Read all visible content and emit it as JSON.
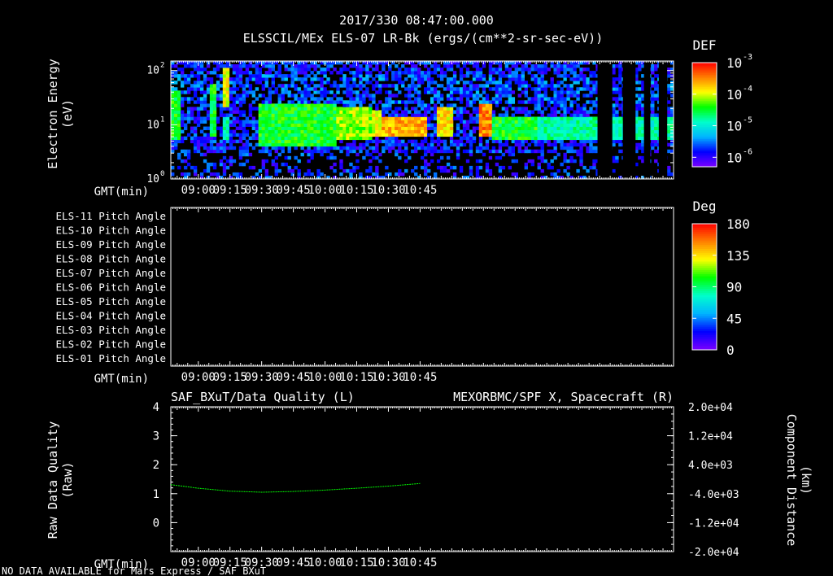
{
  "header": {
    "datetime": "2017/330 08:47:00.000",
    "title": "ELSSCIL/MEx ELS-07 LR-Bk  (ergs/(cm**2-sr-sec-eV))"
  },
  "footer": {
    "note": "NO DATA AVAILABLE for Mars Express / SAF_BXuT"
  },
  "time_axis": {
    "label": "GMT(min)",
    "ticks": [
      "09:00",
      "09:15",
      "09:30",
      "09:45",
      "10:00",
      "10:15",
      "10:30",
      "10:45"
    ],
    "range_min": [
      527,
      765
    ],
    "tick_minutes": [
      540,
      555,
      570,
      585,
      600,
      615,
      630,
      645
    ]
  },
  "chart_data": [
    {
      "type": "heatmap",
      "panel": "electron-spectrogram",
      "ylabel_line1": "Electron Energy",
      "ylabel_line2": "(eV)",
      "y_scale": "log",
      "ylim": [
        1,
        150
      ],
      "y_ticks": [
        {
          "base": "10",
          "exp": "0"
        },
        {
          "base": "10",
          "exp": "1"
        },
        {
          "base": "10",
          "exp": "2"
        }
      ],
      "colorbar": {
        "title": "DEF",
        "scale": "log",
        "range": [
          5e-07,
          0.001
        ],
        "ticks": [
          {
            "base": "10",
            "exp": "-3"
          },
          {
            "base": "10",
            "exp": "-4"
          },
          {
            "base": "10",
            "exp": "-5"
          },
          {
            "base": "10",
            "exp": "-6"
          }
        ],
        "colors": [
          "#7a00ff",
          "#0000ff",
          "#00b4ff",
          "#00ffcc",
          "#00ff00",
          "#ffff00",
          "#ff8000",
          "#ff0000"
        ]
      },
      "data_gaps_min": [
        [
          729,
          736
        ],
        [
          741,
          747
        ],
        [
          751,
          754
        ],
        [
          758,
          762
        ]
      ],
      "activity": [
        {
          "t": [
            527,
            532
          ],
          "e": [
            5,
            40
          ],
          "level": 0.55
        },
        {
          "t": [
            546,
            549
          ],
          "e": [
            6,
            60
          ],
          "level": 0.55
        },
        {
          "t": [
            552,
            555
          ],
          "e": [
            20,
            120
          ],
          "level": 0.7
        },
        {
          "t": [
            552,
            555
          ],
          "e": [
            5,
            15
          ],
          "level": 0.45
        },
        {
          "t": [
            568,
            606
          ],
          "e": [
            4,
            25
          ],
          "level": 0.55
        },
        {
          "t": [
            606,
            622
          ],
          "e": [
            5,
            20
          ],
          "level": 0.65
        },
        {
          "t": [
            622,
            627
          ],
          "e": [
            6,
            18
          ],
          "level": 0.72
        },
        {
          "t": [
            627,
            648
          ],
          "e": [
            6,
            15
          ],
          "level": 0.8
        },
        {
          "t": [
            653,
            660
          ],
          "e": [
            6,
            20
          ],
          "level": 0.75
        },
        {
          "t": [
            673,
            679
          ],
          "e": [
            6,
            25
          ],
          "level": 0.85
        },
        {
          "t": [
            679,
            700
          ],
          "e": [
            5,
            15
          ],
          "level": 0.55
        },
        {
          "t": [
            700,
            765
          ],
          "e": [
            5,
            15
          ],
          "level": 0.45
        }
      ]
    },
    {
      "type": "heatmap",
      "panel": "pitch-angle",
      "colorbar": {
        "title": "Deg",
        "range": [
          0,
          180
        ],
        "ticks": [
          "180",
          "135",
          "90",
          "45",
          "0"
        ],
        "colors": [
          "#7a00ff",
          "#0000ff",
          "#00b4ff",
          "#00ffcc",
          "#00ff00",
          "#ffff00",
          "#ff8000",
          "#ff0000"
        ]
      },
      "rows": [
        "ELS-11 Pitch Angle",
        "ELS-10 Pitch Angle",
        "ELS-09 Pitch Angle",
        "ELS-08 Pitch Angle",
        "ELS-07 Pitch Angle",
        "ELS-06 Pitch Angle",
        "ELS-05 Pitch Angle",
        "ELS-04 Pitch Angle",
        "ELS-03 Pitch Angle",
        "ELS-02 Pitch Angle",
        "ELS-01 Pitch Angle"
      ],
      "values": []
    },
    {
      "type": "line",
      "panel": "quality-and-position",
      "left_title": "SAF_BXuT/Data Quality (L)",
      "right_title": "MEXORBMC/SPF X, Spacecraft (R)",
      "right_color": "#00ff00",
      "ylabel_left_line1": "Raw Data Quality",
      "ylabel_left_line2": "(Raw)",
      "ylabel_right_line1": "Component Distance",
      "ylabel_right_line2": "(km)",
      "ylim_left": [
        -1,
        4
      ],
      "left_ticks": [
        "4",
        "3",
        "2",
        "1",
        "0"
      ],
      "ylim_right": [
        -20000,
        20000
      ],
      "right_ticks": [
        "2.0e+04",
        "1.2e+04",
        "4.0e+03",
        "-4.0e+03",
        "-1.2e+04",
        "-2.0e+04"
      ],
      "series": [
        {
          "name": "MEXORBMC/SPF X, Spacecraft (R)",
          "x": [
            527,
            540,
            555,
            570,
            585,
            600,
            615,
            630,
            645
          ],
          "y": [
            -1500,
            -2500,
            -3300,
            -3600,
            -3400,
            -3000,
            -2500,
            -1900,
            -1200
          ]
        }
      ]
    }
  ]
}
